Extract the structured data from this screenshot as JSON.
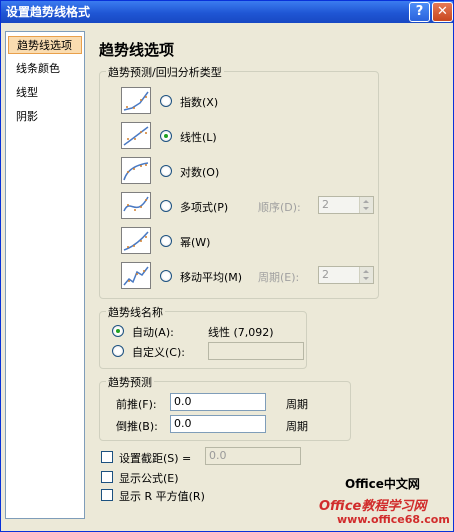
{
  "window": {
    "title": "设置趋势线格式",
    "help": "?",
    "close": "✕"
  },
  "sidebar": {
    "items": [
      {
        "label": "趋势线选项"
      },
      {
        "label": "线条颜色"
      },
      {
        "label": "线型"
      },
      {
        "label": "阴影"
      }
    ]
  },
  "main": {
    "heading": "趋势线选项"
  },
  "regression": {
    "label": "趋势预测/回归分析类型",
    "options": [
      {
        "label": "指数(X)",
        "checked": false,
        "icon": "exponential-trend-icon"
      },
      {
        "label": "线性(L)",
        "checked": true,
        "icon": "linear-trend-icon"
      },
      {
        "label": "对数(O)",
        "checked": false,
        "icon": "logarithmic-trend-icon"
      },
      {
        "label": "多项式(P)",
        "checked": false,
        "icon": "polynomial-trend-icon"
      },
      {
        "label": "幂(W)",
        "checked": false,
        "icon": "power-trend-icon"
      },
      {
        "label": "移动平均(M)",
        "checked": false,
        "icon": "moving-average-icon"
      }
    ],
    "order_label": "顺序(D):",
    "order_value": "2",
    "period_label": "周期(E):",
    "period_value": "2"
  },
  "trendname": {
    "label": "趋势线名称",
    "auto_label": "自动(A):",
    "auto_value": "线性 (7,092)",
    "custom_label": "自定义(C):",
    "custom_value": ""
  },
  "forecast": {
    "label": "趋势预测",
    "forward_label": "前推(F):",
    "forward_value": "0.0",
    "forward_unit": "周期",
    "backward_label": "倒推(B):",
    "backward_value": "0.0",
    "backward_unit": "周期"
  },
  "options": {
    "intercept_label": "设置截距(S) =",
    "intercept_value": "0.0",
    "equation_label": "显示公式(E)",
    "r2_label": "显示 R 平方值(R)"
  },
  "watermark": {
    "line1": "Office中文网",
    "line2": "Office教程学习网",
    "line3": "www.office68.com"
  }
}
